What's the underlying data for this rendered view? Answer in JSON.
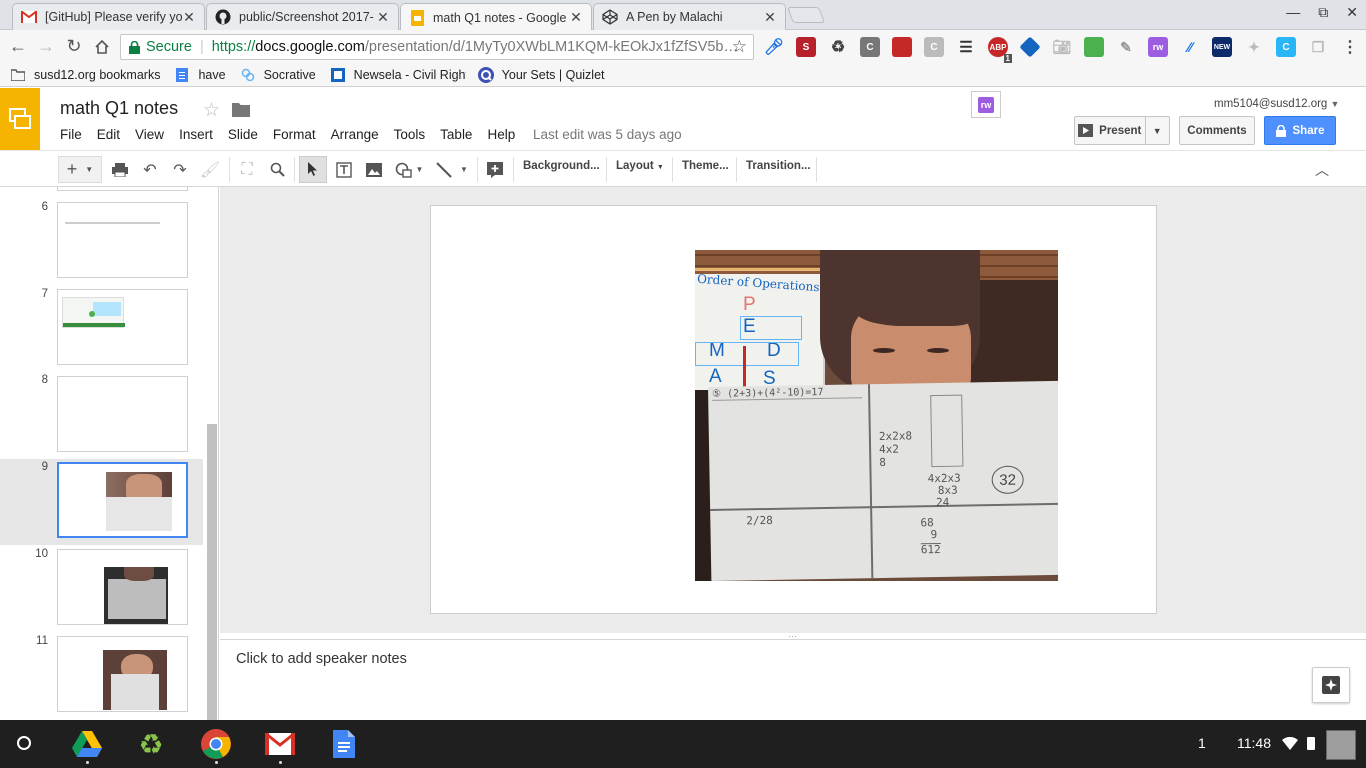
{
  "browser": {
    "tabs": [
      {
        "title": "[GitHub] Please verify yo",
        "icon": "gmail-icon"
      },
      {
        "title": "public/Screenshot 2017-",
        "icon": "github-icon"
      },
      {
        "title": "math Q1 notes - Google",
        "icon": "slides-icon",
        "active": true
      },
      {
        "title": "A Pen by Malachi",
        "icon": "codepen-icon"
      }
    ],
    "secure_label": "Secure",
    "url_scheme": "https://",
    "url_host": "docs.google.com",
    "url_path": "/presentation/d/1MyTy0XWbLM1KQM-kEOkJx1fZfSV5b…",
    "abp_count": "1"
  },
  "bookmarks": [
    {
      "label": "susd12.org bookmarks",
      "icon": "folder-icon"
    },
    {
      "label": "have",
      "icon": "doc-icon"
    },
    {
      "label": "Socrative",
      "icon": "socrative-icon"
    },
    {
      "label": "Newsela - Civil Rights",
      "icon": "newsela-icon"
    },
    {
      "label": "Your Sets | Quizlet",
      "icon": "quizlet-icon"
    }
  ],
  "app": {
    "title": "math Q1 notes",
    "menu": [
      "File",
      "Edit",
      "View",
      "Insert",
      "Slide",
      "Format",
      "Arrange",
      "Tools",
      "Table",
      "Help"
    ],
    "last_edit": "Last edit was 5 days ago",
    "user": "mm5104@susd12.org",
    "present_label": "Present",
    "comments_label": "Comments",
    "share_label": "Share",
    "ext_badge": "rw"
  },
  "toolbar": {
    "background": "Background...",
    "layout": "Layout",
    "theme": "Theme...",
    "transition": "Transition..."
  },
  "filmstrip": {
    "slides": [
      {
        "num": "6",
        "kind": "text",
        "snippet": "Math Q1 notes 6"
      },
      {
        "num": "7",
        "kind": "screenshot"
      },
      {
        "num": "8",
        "kind": "blank"
      },
      {
        "num": "9",
        "kind": "photo",
        "selected": true
      },
      {
        "num": "10",
        "kind": "photo-dark"
      },
      {
        "num": "11",
        "kind": "photo"
      }
    ]
  },
  "slide": {
    "poster_heading": "Order of Operations",
    "poster_letters": [
      "P",
      "E",
      "M",
      "D",
      "A",
      "S"
    ],
    "paper_circled": "32",
    "paper_notes": [
      "2x2x8",
      "4x2",
      "8",
      "4x2x3",
      "8x3",
      "24",
      "2/28",
      "68",
      "9",
      "612"
    ]
  },
  "notes": {
    "placeholder": "Click to add speaker notes"
  },
  "shelf": {
    "apps": [
      "drive-icon",
      "recycle-icon",
      "chrome-icon",
      "gmail-icon",
      "docs-icon"
    ],
    "notification_count": "1",
    "time": "11:48"
  },
  "colors": {
    "slides_yellow": "#f4b400",
    "share_blue": "#4d90fe",
    "selection_blue": "#4285f4",
    "gmail_red": "#d93025",
    "shelf": "#1f1f1f"
  }
}
